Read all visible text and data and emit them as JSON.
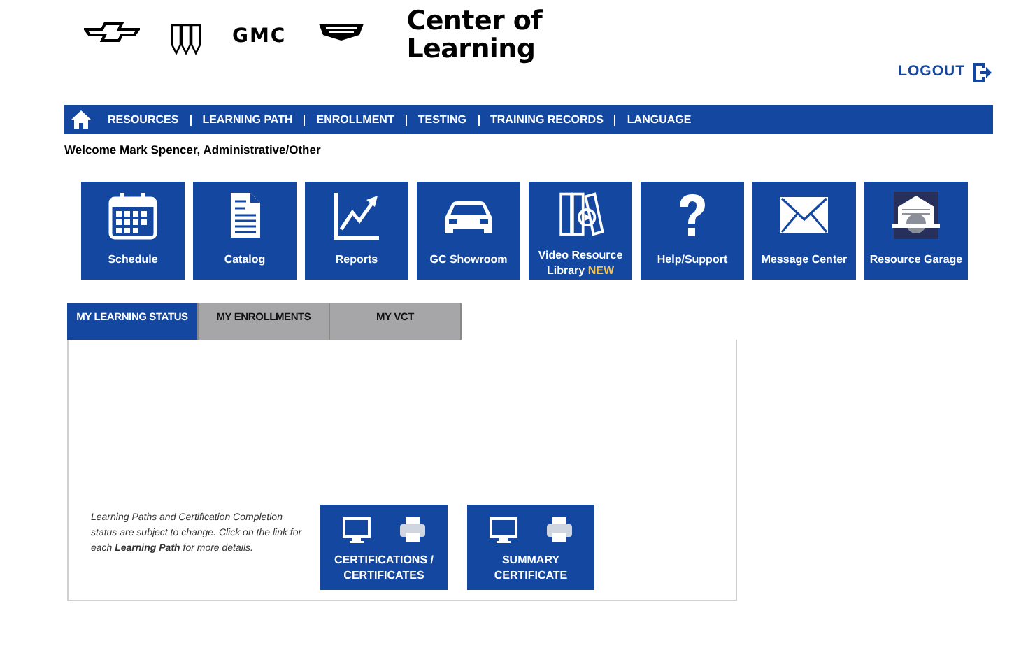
{
  "header": {
    "logo_text": "GMC",
    "title": "Center of Learning",
    "logout": "LOGOUT"
  },
  "nav": {
    "items": [
      "RESOURCES",
      "LEARNING PATH",
      "ENROLLMENT",
      "TESTING",
      "TRAINING RECORDS",
      "LANGUAGE"
    ]
  },
  "welcome": "Welcome Mark Spencer, Administrative/Other",
  "tiles": [
    {
      "label": "Schedule"
    },
    {
      "label": "Catalog"
    },
    {
      "label": "Reports"
    },
    {
      "label": "GC Showroom"
    },
    {
      "label": "Video Resource Library",
      "badge": "NEW"
    },
    {
      "label": "Help/Support"
    },
    {
      "label": "Message Center"
    },
    {
      "label": "Resource Garage"
    }
  ],
  "tabs": [
    {
      "label": "MY LEARNING STATUS",
      "selected": true
    },
    {
      "label": "MY ENROLLMENTS",
      "selected": false
    },
    {
      "label": "MY VCT",
      "selected": false
    }
  ],
  "note": "Learning Paths and Certification Completion status are subject to change. Click on the link for each **Learning Path** for more details.",
  "buttons": [
    {
      "label": "CERTIFICATIONS / CERTIFICATES"
    },
    {
      "label": "SUMMARY CERTIFICATE"
    }
  ]
}
